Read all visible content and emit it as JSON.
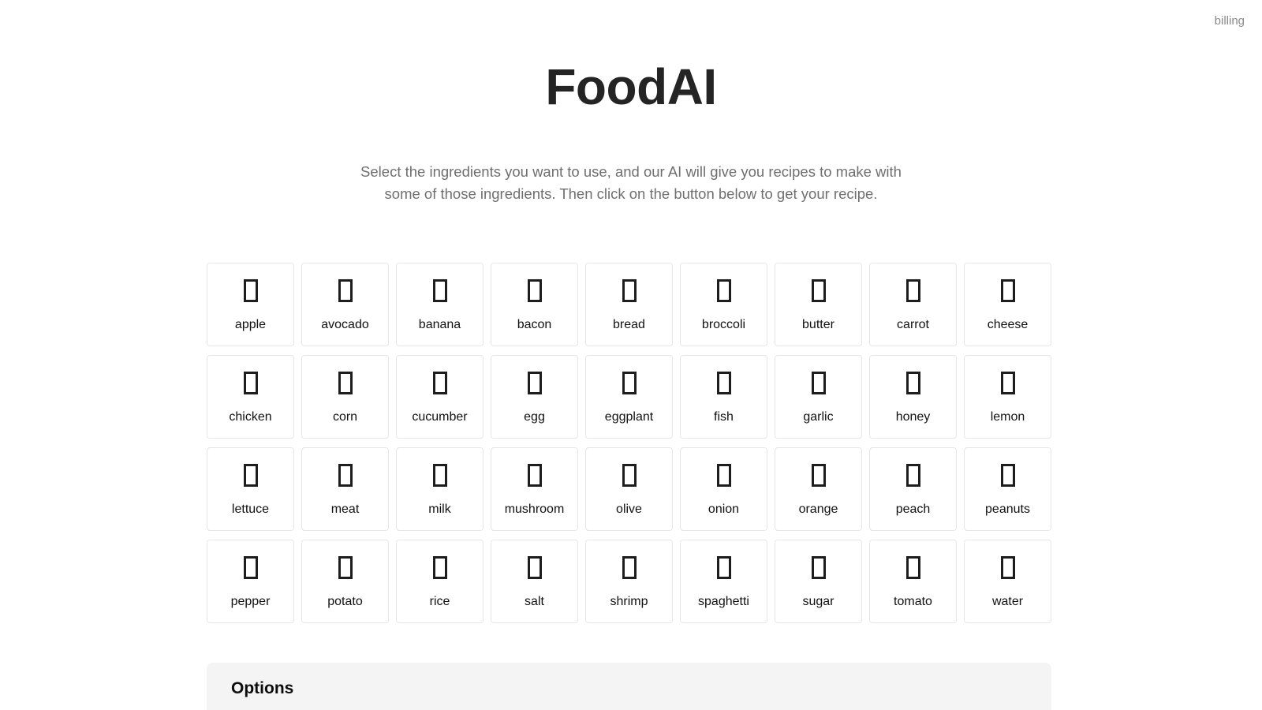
{
  "topbar": {
    "billing_label": "billing"
  },
  "header": {
    "title": "FoodAI",
    "description": "Select the ingredients you want to use, and our AI will give you recipes to make with some of those ingredients. Then click on the button below to get your recipe."
  },
  "ingredients": {
    "icon_name": "missing-glyph-box-icon",
    "items": [
      {
        "label": "apple"
      },
      {
        "label": "avocado"
      },
      {
        "label": "banana"
      },
      {
        "label": "bacon"
      },
      {
        "label": "bread"
      },
      {
        "label": "broccoli"
      },
      {
        "label": "butter"
      },
      {
        "label": "carrot"
      },
      {
        "label": "cheese"
      },
      {
        "label": "chicken"
      },
      {
        "label": "corn"
      },
      {
        "label": "cucumber"
      },
      {
        "label": "egg"
      },
      {
        "label": "eggplant"
      },
      {
        "label": "fish"
      },
      {
        "label": "garlic"
      },
      {
        "label": "honey"
      },
      {
        "label": "lemon"
      },
      {
        "label": "lettuce"
      },
      {
        "label": "meat"
      },
      {
        "label": "milk"
      },
      {
        "label": "mushroom"
      },
      {
        "label": "olive"
      },
      {
        "label": "onion"
      },
      {
        "label": "orange"
      },
      {
        "label": "peach"
      },
      {
        "label": "peanuts"
      },
      {
        "label": "pepper"
      },
      {
        "label": "potato"
      },
      {
        "label": "rice"
      },
      {
        "label": "salt"
      },
      {
        "label": "shrimp"
      },
      {
        "label": "spaghetti"
      },
      {
        "label": "sugar"
      },
      {
        "label": "tomato"
      },
      {
        "label": "water"
      }
    ]
  },
  "options": {
    "title": "Options"
  },
  "colors": {
    "page_background": "#ffffff",
    "title_text": "#242424",
    "description_text": "#6f6f6f",
    "billing_text": "#8a8a8a",
    "card_border": "#e6e6e6",
    "card_background": "#ffffff",
    "label_text": "#111111",
    "options_background": "#f4f4f4",
    "options_title": "#0d0d0d"
  }
}
